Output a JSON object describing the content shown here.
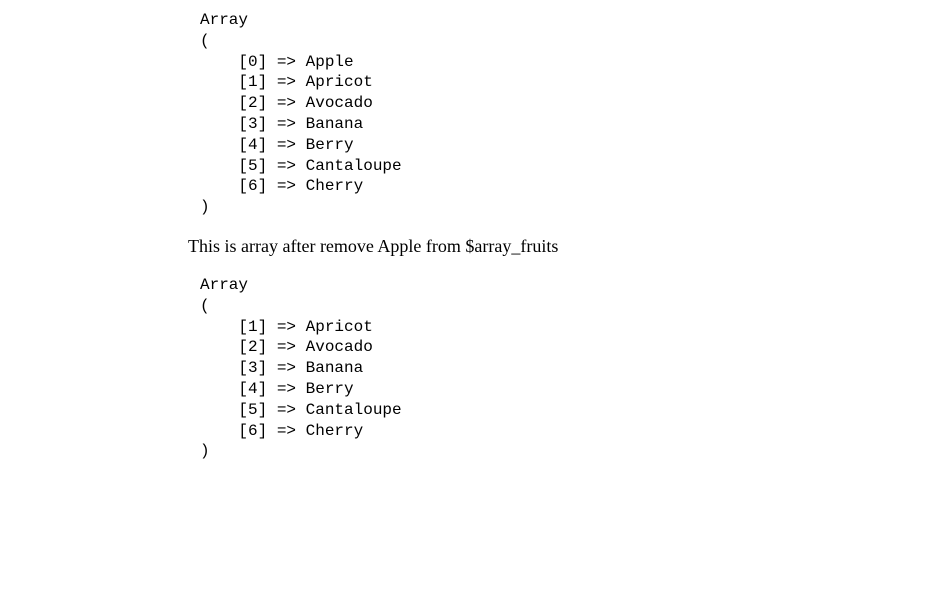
{
  "block1": {
    "header": "Array",
    "open": "(",
    "entry0": "    [0] => Apple",
    "entry1": "    [1] => Apricot",
    "entry2": "    [2] => Avocado",
    "entry3": "    [3] => Banana",
    "entry4": "    [4] => Berry",
    "entry5": "    [5] => Cantaloupe",
    "entry6": "    [6] => Cherry",
    "close": ")"
  },
  "description": "This is array after remove Apple from $array_fruits",
  "block2": {
    "header": "Array",
    "open": "(",
    "entry1": "    [1] => Apricot",
    "entry2": "    [2] => Avocado",
    "entry3": "    [3] => Banana",
    "entry4": "    [4] => Berry",
    "entry5": "    [5] => Cantaloupe",
    "entry6": "    [6] => Cherry",
    "close": ")"
  }
}
